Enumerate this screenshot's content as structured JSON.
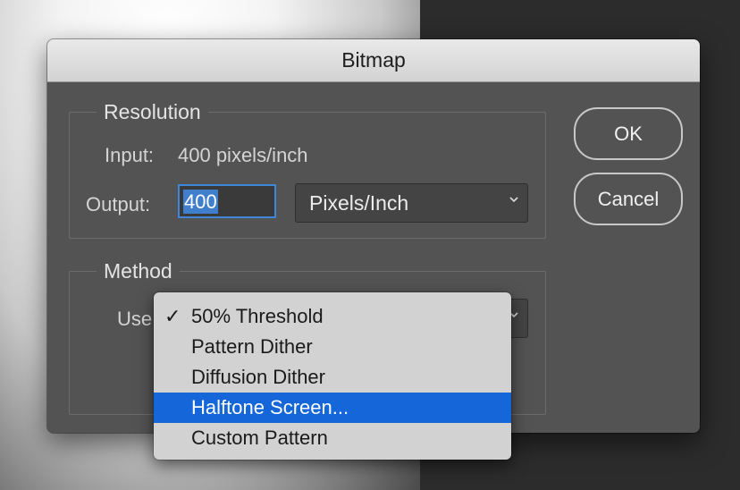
{
  "dialog": {
    "title": "Bitmap"
  },
  "resolution": {
    "legend": "Resolution",
    "input_label": "Input:",
    "input_value": "400 pixels/inch",
    "output_label": "Output:",
    "output_value": "400",
    "unit_selected": "Pixels/Inch"
  },
  "method": {
    "legend": "Method",
    "use_label": "Use",
    "menu_items": [
      {
        "label": "50% Threshold",
        "checked": true
      },
      {
        "label": "Pattern Dither"
      },
      {
        "label": "Diffusion Dither"
      },
      {
        "label": "Halftone Screen...",
        "highlighted": true
      },
      {
        "label": "Custom Pattern"
      }
    ]
  },
  "buttons": {
    "ok": "OK",
    "cancel": "Cancel"
  },
  "icons": {
    "check": "✓",
    "chevron": "chevron-down-icon"
  },
  "colors": {
    "highlight": "#1466d9",
    "focus_ring": "#3d86d8"
  }
}
